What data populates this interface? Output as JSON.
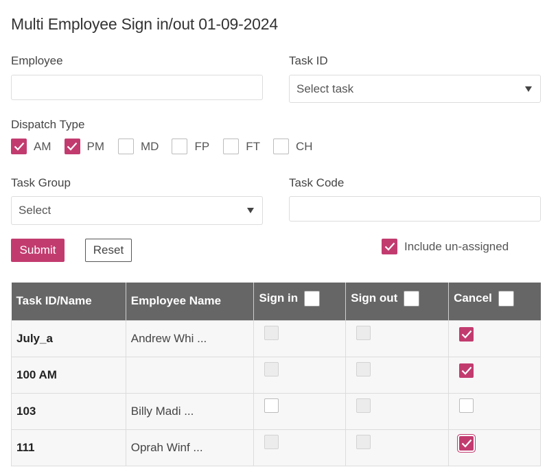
{
  "page": {
    "title": "Multi Employee Sign in/out 01-09-2024"
  },
  "form": {
    "employee_label": "Employee",
    "employee_value": "",
    "task_id_label": "Task ID",
    "task_id_value": "Select task",
    "dispatch_type_label": "Dispatch Type",
    "dispatch_types": [
      {
        "label": "AM",
        "checked": true
      },
      {
        "label": "PM",
        "checked": true
      },
      {
        "label": "MD",
        "checked": false
      },
      {
        "label": "FP",
        "checked": false
      },
      {
        "label": "FT",
        "checked": false
      },
      {
        "label": "CH",
        "checked": false
      }
    ],
    "task_group_label": "Task Group",
    "task_group_value": "Select",
    "task_code_label": "Task Code",
    "task_code_value": "",
    "submit_label": "Submit",
    "reset_label": "Reset",
    "include_unassigned_label": "Include un-assigned",
    "include_unassigned_checked": true
  },
  "table": {
    "headers": {
      "task": "Task ID/Name",
      "employee": "Employee Name",
      "sign_in": "Sign in",
      "sign_out": "Sign out",
      "cancel": "Cancel"
    },
    "rows": [
      {
        "task": "July_a",
        "employee": "Andrew Whi ...",
        "sign_in": "disabled",
        "sign_out": "disabled",
        "cancel": "checked"
      },
      {
        "task": "100 AM",
        "employee": "",
        "sign_in": "disabled",
        "sign_out": "disabled",
        "cancel": "checked"
      },
      {
        "task": "103",
        "employee": "Billy Madi ...",
        "sign_in": "unchecked",
        "sign_out": "disabled",
        "cancel": "unchecked"
      },
      {
        "task": "111",
        "employee": "Oprah Winf ...",
        "sign_in": "disabled",
        "sign_out": "disabled",
        "cancel": "checked-focused"
      }
    ]
  },
  "colors": {
    "accent": "#c23b6f",
    "header_bg": "#666666"
  }
}
